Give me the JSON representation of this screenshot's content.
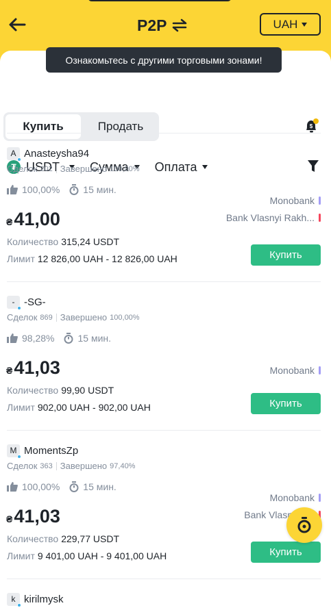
{
  "header": {
    "title": "P2P",
    "currency": "UAH"
  },
  "tooltip": "Ознакомьтесь с другими торговыми зонами!",
  "tabs": {
    "buy": "Купить",
    "sell": "Продать"
  },
  "filters": {
    "asset": "USDT",
    "amount": "Сумма",
    "payment": "Оплата"
  },
  "labels": {
    "trades": "Сделок",
    "completed": "Завершено",
    "quantity": "Количество",
    "limit": "Лимит",
    "currency_symbol": "₴",
    "buy_button": "Купить"
  },
  "colors": {
    "brand": "#fcd535",
    "buy": "#2ebd85",
    "monobank": "#a39df6",
    "bank_vlasnyi": "#f6465d"
  },
  "offers": [
    {
      "initial": "A",
      "name": "Anasteysha94",
      "trades": "202",
      "completion": "100,00%",
      "positive_rate": "100,00%",
      "time": "15 мин.",
      "price": "41,00",
      "quantity": "315,24 USDT",
      "limit": "12 826,00 UAH - 12 826,00 UAH",
      "payments": [
        "Monobank",
        "Bank Vlasnyi Rakh..."
      ]
    },
    {
      "initial": "-",
      "name": "-SG-",
      "trades": "869",
      "completion": "100,00%",
      "positive_rate": "98,28%",
      "time": "15 мин.",
      "price": "41,03",
      "quantity": "99,90 USDT",
      "limit": "902,00 UAH - 902,00 UAH",
      "payments": [
        "Monobank"
      ]
    },
    {
      "initial": "M",
      "name": "MomentsZp",
      "trades": "363",
      "completion": "97,40%",
      "positive_rate": "100,00%",
      "time": "15 мин.",
      "price": "41,03",
      "quantity": "229,77 USDT",
      "limit": "9 401,00 UAH - 9 401,00 UAH",
      "payments": [
        "Monobank",
        "Bank Vlasnyi Ra"
      ]
    },
    {
      "initial": "k",
      "name": "kirilmysk"
    }
  ]
}
